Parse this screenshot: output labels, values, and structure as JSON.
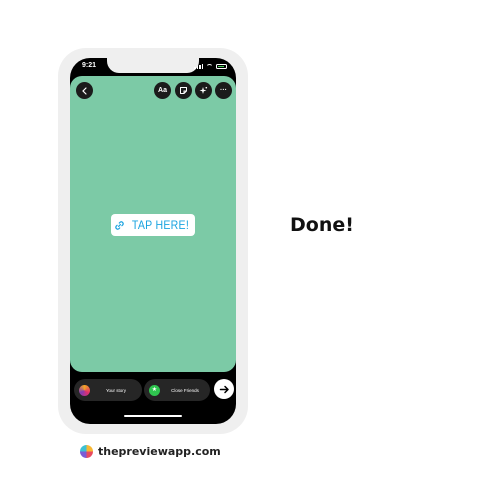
{
  "status_bar": {
    "time": "9:21"
  },
  "toolbar": {
    "text_tool_label": "Aa",
    "more_label": "···"
  },
  "sticker": {
    "label": "TAP HERE!"
  },
  "bottom_bar": {
    "your_story_label": "Your story",
    "close_friends_label": "Close Friends"
  },
  "side": {
    "caption": "Done!"
  },
  "footer": {
    "brand": "thepreviewapp.com"
  },
  "colors": {
    "story_background": "#7ccaa6",
    "link_text": "#1aa3e0",
    "phone_frame": "#efefef",
    "close_friends_green": "#2fc64f"
  }
}
